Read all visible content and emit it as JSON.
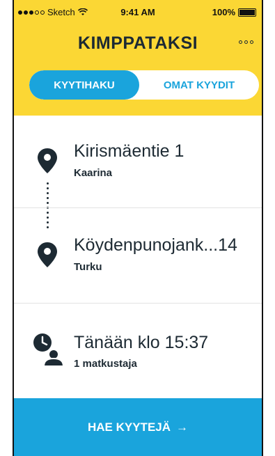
{
  "status_bar": {
    "carrier": "Sketch",
    "time": "9:41 AM",
    "battery": "100%"
  },
  "header": {
    "title": "KIMPPATAKSI",
    "more_icon": "more-icon"
  },
  "tabs": [
    {
      "label": "KYYTIHAKU",
      "active": true
    },
    {
      "label": "OMAT KYYDIT",
      "active": false
    }
  ],
  "route": {
    "from": {
      "street": "Kirismäentie 1",
      "city": "Kaarina"
    },
    "to": {
      "street": "Köydenpunojank...14",
      "city": "Turku"
    }
  },
  "schedule": {
    "time": "Tänään klo 15:37",
    "passengers": "1 matkustaja"
  },
  "cta": {
    "label": "HAE KYYTEJÄ",
    "arrow": "→"
  },
  "colors": {
    "header_yellow": "#fbd734",
    "accent_blue": "#1aa4dc",
    "text_dark": "#1d2a33"
  }
}
